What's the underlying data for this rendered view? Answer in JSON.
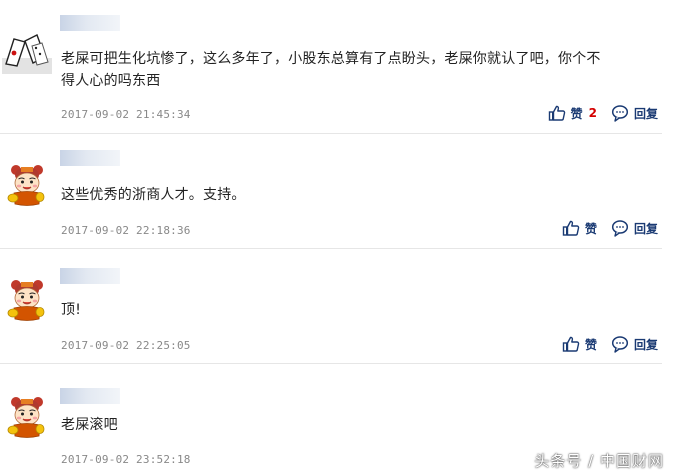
{
  "comments": [
    {
      "avatar": "photo-avatar",
      "text_line1": "老屎可把生化坑惨了，这么多年了，小股东总算有了点盼头，老屎你就认了吧，你个不",
      "text_line2": "得人心的吗东西",
      "time": "2017-09-02 21:45:34",
      "like_label": "赞",
      "like_count": "2",
      "reply_label": "回复"
    },
    {
      "avatar": "cartoon-avatar",
      "text_line1": "这些优秀的浙商人才。支持。",
      "time": "2017-09-02 22:18:36",
      "like_label": "赞",
      "reply_label": "回复"
    },
    {
      "avatar": "cartoon-avatar",
      "text_line1": "顶!",
      "time": "2017-09-02 22:25:05",
      "like_label": "赞",
      "reply_label": "回复"
    },
    {
      "avatar": "cartoon-avatar",
      "text_line1": "老屎滚吧",
      "time": "2017-09-02 23:52:18"
    }
  ],
  "watermark": "头条号 / 中国财网",
  "colors": {
    "action_blue": "#1a3a73",
    "count_red": "#d40000",
    "divider": "#e6e6e6",
    "timestamp": "#888888"
  },
  "icons": {
    "like": "thumbs-up-icon",
    "reply": "speech-bubble-icon"
  }
}
